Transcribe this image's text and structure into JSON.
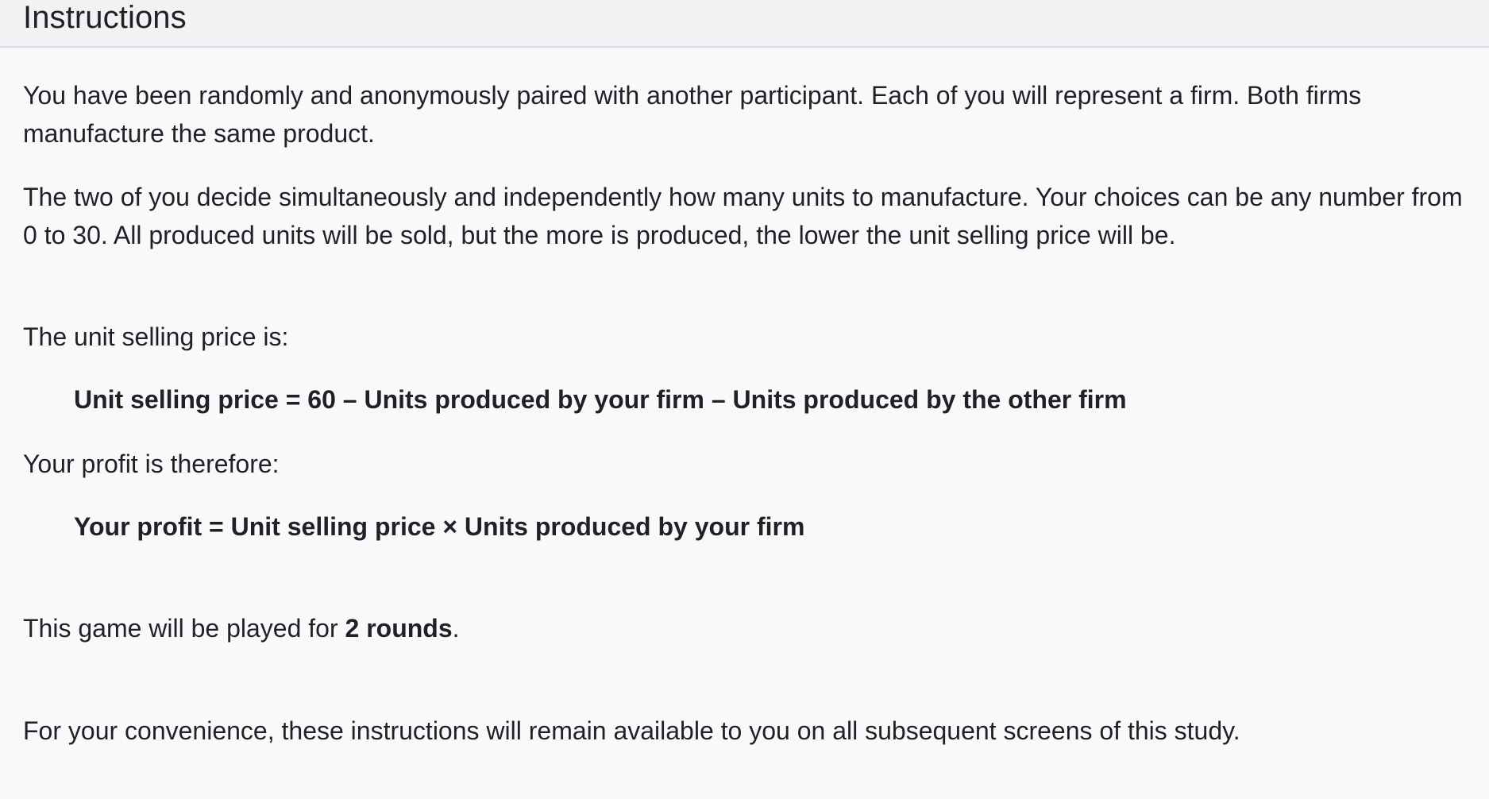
{
  "panel": {
    "title": "Instructions"
  },
  "content": {
    "paragraph_1": "You have been randomly and anonymously paired with another participant. Each of you will represent a firm. Both firms manufacture the same product.",
    "paragraph_2": "The two of you decide simultaneously and independently how many units to manufacture. Your choices can be any number from 0 to 30. All produced units will be sold, but the more is produced, the lower the unit selling price will be.",
    "price_intro": "The unit selling price is:",
    "price_formula": "Unit selling price = 60 – Units produced by your firm – Units produced by the other firm",
    "profit_intro": "Your profit is therefore:",
    "profit_formula": "Your profit = Unit selling price × Units produced by your firm",
    "rounds_prefix": "This game will be played for ",
    "rounds_value": "2 rounds",
    "rounds_suffix": ".",
    "availability_note": "For your convenience, these instructions will remain available to you on all subsequent screens of this study."
  }
}
